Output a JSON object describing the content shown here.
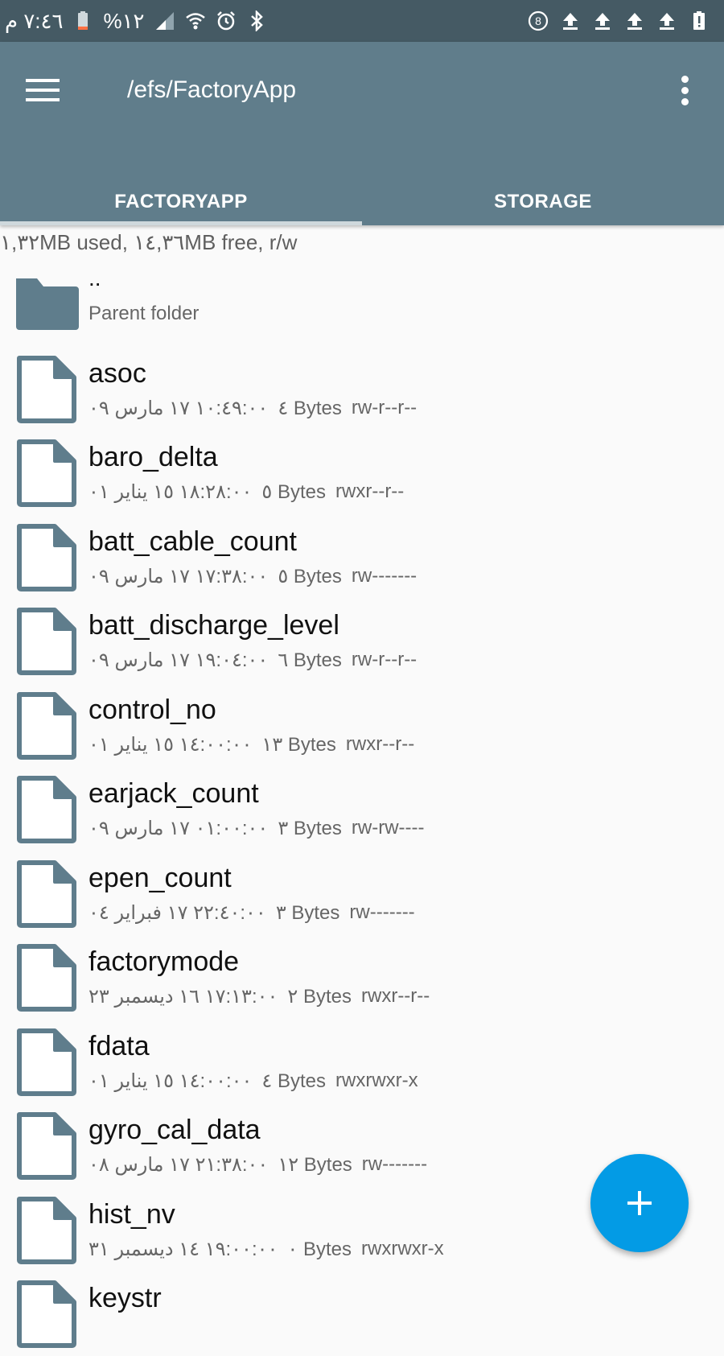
{
  "status_bar": {
    "time": "٧:٤٦ م",
    "battery_percent": "%١٢",
    "icons_left": [
      "battery-icon",
      "signal-icon",
      "wifi-icon",
      "alarm-icon",
      "bluetooth-icon"
    ],
    "icons_right": [
      "notification-8-icon",
      "upload-icon",
      "upload-icon",
      "upload-icon",
      "upload-icon",
      "battery-alert-icon"
    ]
  },
  "app_bar": {
    "title": "/efs/FactoryApp",
    "menu_icon": "hamburger-menu-icon",
    "overflow_icon": "more-vert-icon"
  },
  "tabs": [
    {
      "label": "FACTORYAPP",
      "active": true
    },
    {
      "label": "STORAGE",
      "active": false
    }
  ],
  "usage": "١,٣٢MB used, ١٤,٣٦MB free, r/w",
  "parent": {
    "name": "..",
    "subtitle": "Parent folder"
  },
  "files": [
    {
      "name": "asoc",
      "date": "١٠:٤٩:٠٠ ١٧ مارس ٠٩",
      "size": "٤ Bytes",
      "perm": "rw-r--r--"
    },
    {
      "name": "baro_delta",
      "date": "١٨:٢٨:٠٠ ١٥ يناير ٠١",
      "size": "٥ Bytes",
      "perm": "rwxr--r--"
    },
    {
      "name": "batt_cable_count",
      "date": "١٧:٣٨:٠٠ ١٧ مارس ٠٩",
      "size": "٥ Bytes",
      "perm": "rw-------"
    },
    {
      "name": "batt_discharge_level",
      "date": "١٩:٠٤:٠٠ ١٧ مارس ٠٩",
      "size": "٦ Bytes",
      "perm": "rw-r--r--"
    },
    {
      "name": "control_no",
      "date": "١٤:٠٠:٠٠ ١٥ يناير ٠١",
      "size": "١٣ Bytes",
      "perm": "rwxr--r--"
    },
    {
      "name": "earjack_count",
      "date": "٠١:٠٠:٠٠ ١٧ مارس ٠٩",
      "size": "٣ Bytes",
      "perm": "rw-rw----"
    },
    {
      "name": "epen_count",
      "date": "٢٢:٤٠:٠٠ ١٧ فبراير ٠٤",
      "size": "٣ Bytes",
      "perm": "rw-------"
    },
    {
      "name": "factorymode",
      "date": "١٧:١٣:٠٠ ١٦ ديسمبر ٢٣",
      "size": "٢ Bytes",
      "perm": "rwxr--r--"
    },
    {
      "name": "fdata",
      "date": "١٤:٠٠:٠٠ ١٥ يناير ٠١",
      "size": "٤ Bytes",
      "perm": "rwxrwxr-x"
    },
    {
      "name": "gyro_cal_data",
      "date": "٢١:٣٨:٠٠ ١٧ مارس ٠٨",
      "size": "١٢ Bytes",
      "perm": "rw-------"
    },
    {
      "name": "hist_nv",
      "date": "١٩:٠٠:٠٠ ١٤ ديسمبر ٣١",
      "size": "٠ Bytes",
      "perm": "rwxrwxr-x"
    },
    {
      "name": "keystr",
      "date": "",
      "size": "",
      "perm": ""
    }
  ],
  "fab": {
    "icon": "plus-icon"
  },
  "colors": {
    "status_bar": "#455a64",
    "app_bar": "#607d8b",
    "fab": "#039be5",
    "icon": "#5f7d8c"
  }
}
